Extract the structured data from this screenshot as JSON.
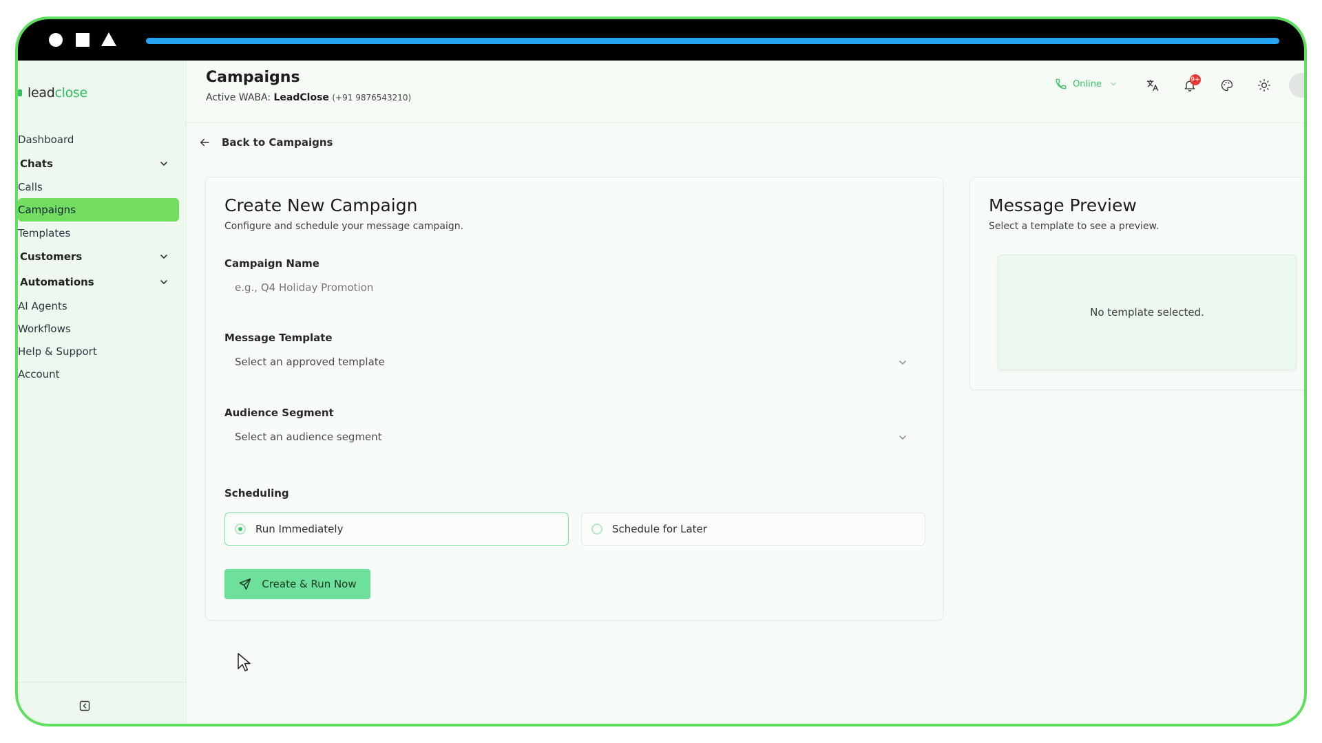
{
  "topbar": {
    "progress_percent": 100
  },
  "brand": {
    "name_part1": "lead",
    "name_part2": "close"
  },
  "sidebar": {
    "items": [
      {
        "label": "Dashboard"
      },
      {
        "label": "Chats"
      },
      {
        "label": "Calls"
      },
      {
        "label": "Campaigns"
      },
      {
        "label": "Templates"
      },
      {
        "label": "Customers"
      },
      {
        "label": "Automations"
      },
      {
        "label": "AI Agents"
      },
      {
        "label": "Workflows"
      },
      {
        "label": "Help & Support"
      },
      {
        "label": "Account"
      }
    ]
  },
  "header": {
    "title": "Campaigns",
    "waba_prefix": "Active WABA:",
    "waba_name": "LeadClose",
    "waba_phone": "(+91 9876543210)",
    "status": "Online",
    "notification_badge": "9+"
  },
  "back_link": "Back to Campaigns",
  "form": {
    "title": "Create New Campaign",
    "subtitle": "Configure and schedule your message campaign.",
    "campaign_name_label": "Campaign Name",
    "campaign_name_placeholder": "e.g., Q4 Holiday Promotion",
    "template_label": "Message Template",
    "template_placeholder": "Select an approved template",
    "audience_label": "Audience Segment",
    "audience_placeholder": "Select an audience segment",
    "scheduling_label": "Scheduling",
    "run_immediately": "Run Immediately",
    "schedule_later": "Schedule for Later",
    "submit": "Create & Run Now"
  },
  "preview": {
    "title": "Message Preview",
    "subtitle": "Select a template to see a preview.",
    "empty": "No template selected."
  },
  "colors": {
    "frame_border": "#5ee05e",
    "accent_green": "#72dd60",
    "button_green": "#6fe09b",
    "progress_blue": "#26a5f2"
  }
}
